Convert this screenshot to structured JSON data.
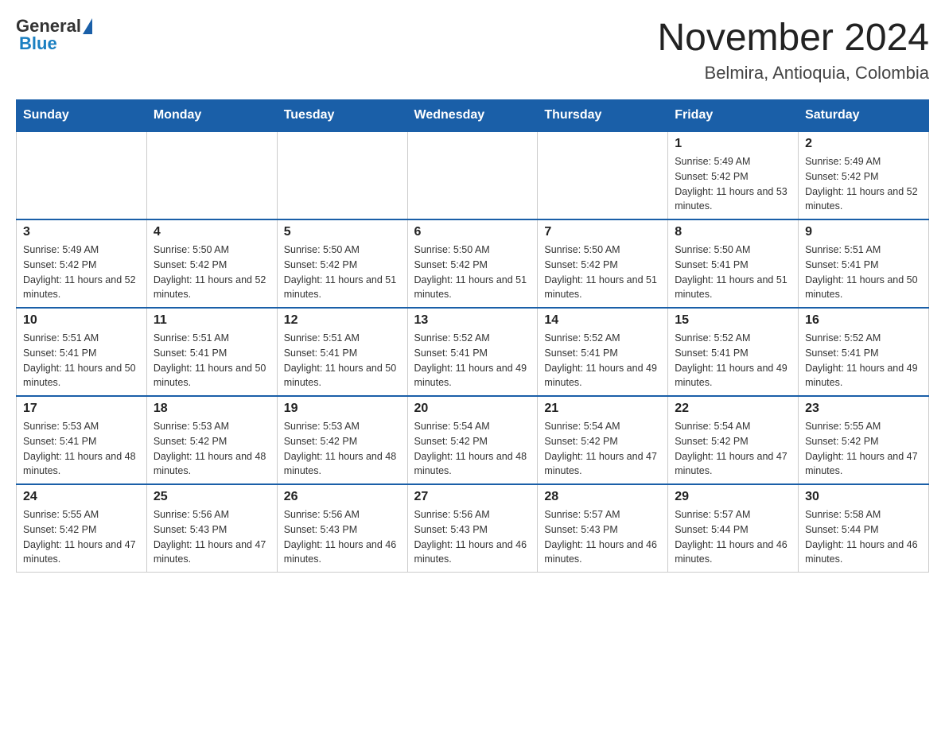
{
  "header": {
    "logo_general": "General",
    "logo_blue": "Blue",
    "month_title": "November 2024",
    "location": "Belmira, Antioquia, Colombia"
  },
  "days_of_week": [
    "Sunday",
    "Monday",
    "Tuesday",
    "Wednesday",
    "Thursday",
    "Friday",
    "Saturday"
  ],
  "weeks": [
    [
      {
        "day": "",
        "sunrise": "",
        "sunset": "",
        "daylight": ""
      },
      {
        "day": "",
        "sunrise": "",
        "sunset": "",
        "daylight": ""
      },
      {
        "day": "",
        "sunrise": "",
        "sunset": "",
        "daylight": ""
      },
      {
        "day": "",
        "sunrise": "",
        "sunset": "",
        "daylight": ""
      },
      {
        "day": "",
        "sunrise": "",
        "sunset": "",
        "daylight": ""
      },
      {
        "day": "1",
        "sunrise": "Sunrise: 5:49 AM",
        "sunset": "Sunset: 5:42 PM",
        "daylight": "Daylight: 11 hours and 53 minutes."
      },
      {
        "day": "2",
        "sunrise": "Sunrise: 5:49 AM",
        "sunset": "Sunset: 5:42 PM",
        "daylight": "Daylight: 11 hours and 52 minutes."
      }
    ],
    [
      {
        "day": "3",
        "sunrise": "Sunrise: 5:49 AM",
        "sunset": "Sunset: 5:42 PM",
        "daylight": "Daylight: 11 hours and 52 minutes."
      },
      {
        "day": "4",
        "sunrise": "Sunrise: 5:50 AM",
        "sunset": "Sunset: 5:42 PM",
        "daylight": "Daylight: 11 hours and 52 minutes."
      },
      {
        "day": "5",
        "sunrise": "Sunrise: 5:50 AM",
        "sunset": "Sunset: 5:42 PM",
        "daylight": "Daylight: 11 hours and 51 minutes."
      },
      {
        "day": "6",
        "sunrise": "Sunrise: 5:50 AM",
        "sunset": "Sunset: 5:42 PM",
        "daylight": "Daylight: 11 hours and 51 minutes."
      },
      {
        "day": "7",
        "sunrise": "Sunrise: 5:50 AM",
        "sunset": "Sunset: 5:42 PM",
        "daylight": "Daylight: 11 hours and 51 minutes."
      },
      {
        "day": "8",
        "sunrise": "Sunrise: 5:50 AM",
        "sunset": "Sunset: 5:41 PM",
        "daylight": "Daylight: 11 hours and 51 minutes."
      },
      {
        "day": "9",
        "sunrise": "Sunrise: 5:51 AM",
        "sunset": "Sunset: 5:41 PM",
        "daylight": "Daylight: 11 hours and 50 minutes."
      }
    ],
    [
      {
        "day": "10",
        "sunrise": "Sunrise: 5:51 AM",
        "sunset": "Sunset: 5:41 PM",
        "daylight": "Daylight: 11 hours and 50 minutes."
      },
      {
        "day": "11",
        "sunrise": "Sunrise: 5:51 AM",
        "sunset": "Sunset: 5:41 PM",
        "daylight": "Daylight: 11 hours and 50 minutes."
      },
      {
        "day": "12",
        "sunrise": "Sunrise: 5:51 AM",
        "sunset": "Sunset: 5:41 PM",
        "daylight": "Daylight: 11 hours and 50 minutes."
      },
      {
        "day": "13",
        "sunrise": "Sunrise: 5:52 AM",
        "sunset": "Sunset: 5:41 PM",
        "daylight": "Daylight: 11 hours and 49 minutes."
      },
      {
        "day": "14",
        "sunrise": "Sunrise: 5:52 AM",
        "sunset": "Sunset: 5:41 PM",
        "daylight": "Daylight: 11 hours and 49 minutes."
      },
      {
        "day": "15",
        "sunrise": "Sunrise: 5:52 AM",
        "sunset": "Sunset: 5:41 PM",
        "daylight": "Daylight: 11 hours and 49 minutes."
      },
      {
        "day": "16",
        "sunrise": "Sunrise: 5:52 AM",
        "sunset": "Sunset: 5:41 PM",
        "daylight": "Daylight: 11 hours and 49 minutes."
      }
    ],
    [
      {
        "day": "17",
        "sunrise": "Sunrise: 5:53 AM",
        "sunset": "Sunset: 5:41 PM",
        "daylight": "Daylight: 11 hours and 48 minutes."
      },
      {
        "day": "18",
        "sunrise": "Sunrise: 5:53 AM",
        "sunset": "Sunset: 5:42 PM",
        "daylight": "Daylight: 11 hours and 48 minutes."
      },
      {
        "day": "19",
        "sunrise": "Sunrise: 5:53 AM",
        "sunset": "Sunset: 5:42 PM",
        "daylight": "Daylight: 11 hours and 48 minutes."
      },
      {
        "day": "20",
        "sunrise": "Sunrise: 5:54 AM",
        "sunset": "Sunset: 5:42 PM",
        "daylight": "Daylight: 11 hours and 48 minutes."
      },
      {
        "day": "21",
        "sunrise": "Sunrise: 5:54 AM",
        "sunset": "Sunset: 5:42 PM",
        "daylight": "Daylight: 11 hours and 47 minutes."
      },
      {
        "day": "22",
        "sunrise": "Sunrise: 5:54 AM",
        "sunset": "Sunset: 5:42 PM",
        "daylight": "Daylight: 11 hours and 47 minutes."
      },
      {
        "day": "23",
        "sunrise": "Sunrise: 5:55 AM",
        "sunset": "Sunset: 5:42 PM",
        "daylight": "Daylight: 11 hours and 47 minutes."
      }
    ],
    [
      {
        "day": "24",
        "sunrise": "Sunrise: 5:55 AM",
        "sunset": "Sunset: 5:42 PM",
        "daylight": "Daylight: 11 hours and 47 minutes."
      },
      {
        "day": "25",
        "sunrise": "Sunrise: 5:56 AM",
        "sunset": "Sunset: 5:43 PM",
        "daylight": "Daylight: 11 hours and 47 minutes."
      },
      {
        "day": "26",
        "sunrise": "Sunrise: 5:56 AM",
        "sunset": "Sunset: 5:43 PM",
        "daylight": "Daylight: 11 hours and 46 minutes."
      },
      {
        "day": "27",
        "sunrise": "Sunrise: 5:56 AM",
        "sunset": "Sunset: 5:43 PM",
        "daylight": "Daylight: 11 hours and 46 minutes."
      },
      {
        "day": "28",
        "sunrise": "Sunrise: 5:57 AM",
        "sunset": "Sunset: 5:43 PM",
        "daylight": "Daylight: 11 hours and 46 minutes."
      },
      {
        "day": "29",
        "sunrise": "Sunrise: 5:57 AM",
        "sunset": "Sunset: 5:44 PM",
        "daylight": "Daylight: 11 hours and 46 minutes."
      },
      {
        "day": "30",
        "sunrise": "Sunrise: 5:58 AM",
        "sunset": "Sunset: 5:44 PM",
        "daylight": "Daylight: 11 hours and 46 minutes."
      }
    ]
  ]
}
